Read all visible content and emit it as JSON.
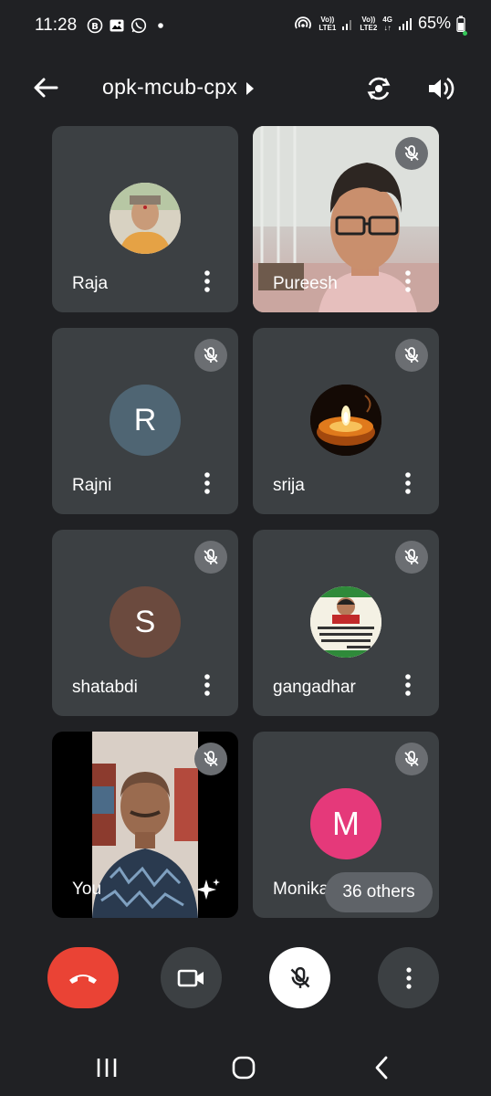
{
  "status_bar": {
    "time": "11:28",
    "lte1_label_top": "Vo))",
    "lte1_label_bottom": "LTE1",
    "lte2_label_top": "Vo))",
    "lte2_label_bottom": "LTE2",
    "net_type": "4G",
    "battery": "65%"
  },
  "header": {
    "meeting_code": "opk-mcub-cpx"
  },
  "participants": [
    {
      "name": "Raja",
      "muted": false,
      "avatar": "photo"
    },
    {
      "name": "Pureesh",
      "muted": true,
      "avatar": "video"
    },
    {
      "name": "Rajni",
      "muted": true,
      "avatar_letter": "R",
      "avatar_color": "#4f6573"
    },
    {
      "name": "srija",
      "muted": true,
      "avatar": "photo"
    },
    {
      "name": "shatabdi",
      "muted": true,
      "avatar_letter": "S",
      "avatar_color": "#6b4a3e"
    },
    {
      "name": "gangadhar",
      "muted": true,
      "avatar": "photo"
    },
    {
      "name": "You",
      "muted": true,
      "avatar": "video"
    },
    {
      "name": "Monika",
      "muted": true,
      "avatar_letter": "M",
      "avatar_color": "#e5397a"
    }
  ],
  "others_label": "36 others",
  "controls": {
    "end_call": "end-call",
    "camera": "camera",
    "mic": "mic-off",
    "more": "more"
  },
  "colors": {
    "background": "#202124",
    "tile": "#3c4043",
    "end_call": "#ea4335",
    "monika_avatar": "#e5397a"
  }
}
